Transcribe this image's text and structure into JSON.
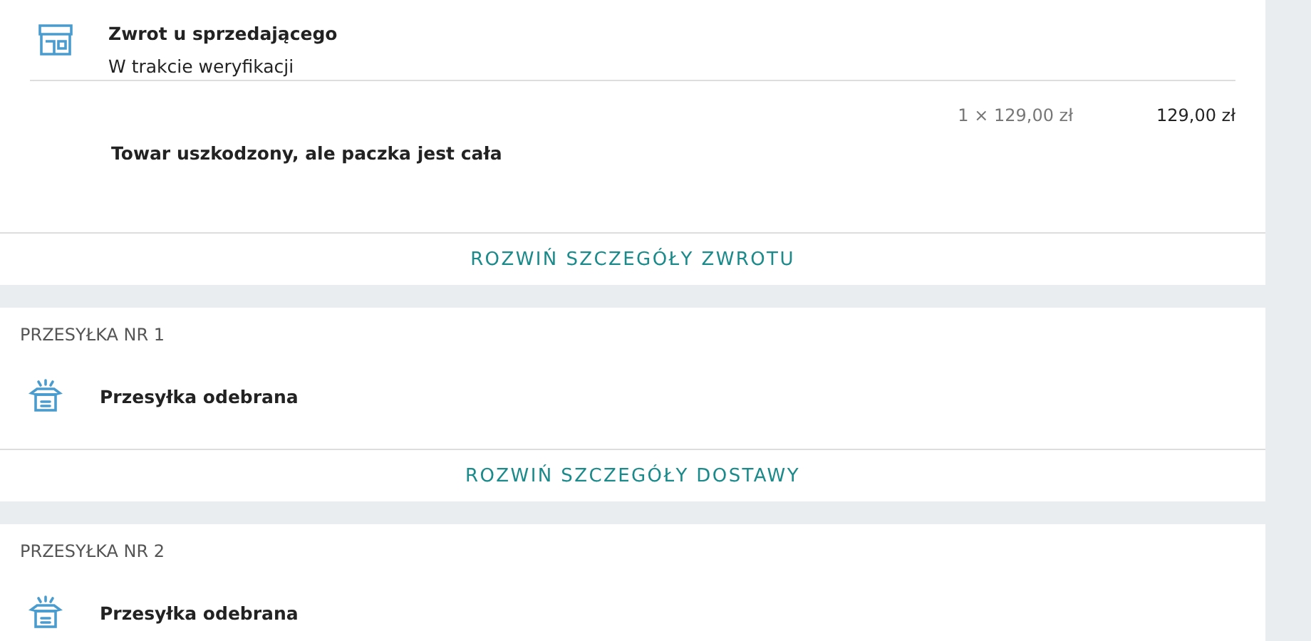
{
  "return": {
    "title": "Zwrot u sprzedającego",
    "status": "W trakcie weryfikacji",
    "item": {
      "quantity_price": "1 × 129,00 zł",
      "total": "129,00 zł",
      "name": "Towar uszkodzony, ale paczka jest cała"
    },
    "expand_button": "ROZWIŃ SZCZEGÓŁY ZWROTU"
  },
  "shipments": [
    {
      "label": "PRZESYŁKA NR 1",
      "status": "Przesyłka odebrana",
      "expand_button": "ROZWIŃ SZCZEGÓŁY DOSTAWY"
    },
    {
      "label": "PRZESYŁKA NR 2",
      "status": "Przesyłka odebrana"
    }
  ]
}
